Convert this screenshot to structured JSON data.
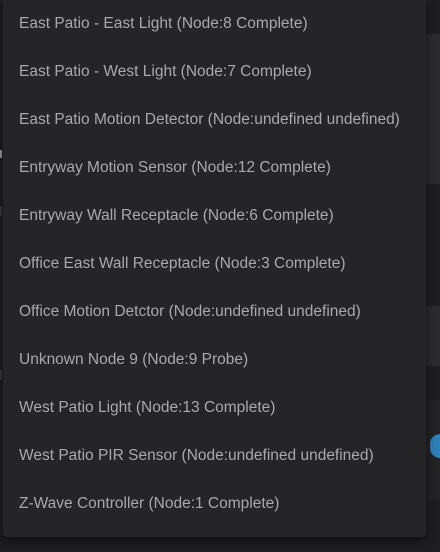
{
  "dropdown": {
    "items": [
      {
        "label": "East Patio - East Light (Node:8 Complete)"
      },
      {
        "label": "East Patio - West Light (Node:7 Complete)"
      },
      {
        "label": "East Patio Motion Detector (Node:undefined undefined)"
      },
      {
        "label": "Entryway Motion Sensor (Node:12 Complete)"
      },
      {
        "label": "Entryway Wall Receptacle (Node:6 Complete)"
      },
      {
        "label": "Office East Wall Receptacle (Node:3 Complete)"
      },
      {
        "label": "Office Motion Detctor (Node:undefined undefined)"
      },
      {
        "label": "Unknown Node 9 (Node:9 Probe)"
      },
      {
        "label": "West Patio Light (Node:13 Complete)"
      },
      {
        "label": "West Patio PIR Sensor (Node:undefined undefined)"
      },
      {
        "label": "Z-Wave Controller (Node:1 Complete)"
      }
    ]
  },
  "colors": {
    "menu_background": "#252528",
    "item_text": "#a9a9ad",
    "page_background": "#1e1e20",
    "accent": "#2f7fb8"
  }
}
